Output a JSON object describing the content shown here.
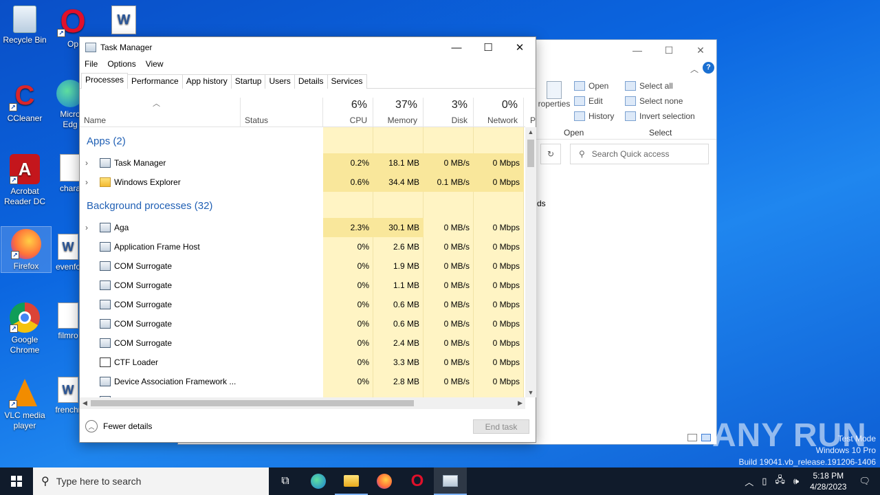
{
  "desktop": {
    "icons": [
      {
        "label": "Recycle Bin"
      },
      {
        "label": "Op"
      },
      {
        "label": ""
      },
      {
        "label": "CCleaner"
      },
      {
        "label": "Micro Edg"
      },
      {
        "label": "Acrobat Reader DC"
      },
      {
        "label": "chara"
      },
      {
        "label": "Firefox"
      },
      {
        "label": "evenfo"
      },
      {
        "label": "Google Chrome"
      },
      {
        "label": "filmro"
      },
      {
        "label": "VLC media player"
      },
      {
        "label": "frenchr"
      }
    ]
  },
  "explorer": {
    "ribbon": {
      "open_items": [
        "Open",
        "Edit",
        "History"
      ],
      "properties_label": "roperties",
      "open_group": "Open",
      "select_items": [
        "Select all",
        "Select none",
        "Invert selection"
      ],
      "select_group": "Select"
    },
    "search_placeholder": "Search Quick access",
    "content_fragment": "ds"
  },
  "task_manager": {
    "title": "Task Manager",
    "menu": [
      "File",
      "Options",
      "View"
    ],
    "tabs": [
      "Processes",
      "Performance",
      "App history",
      "Startup",
      "Users",
      "Details",
      "Services"
    ],
    "active_tab": "Processes",
    "columns": {
      "name": "Name",
      "status": "Status",
      "cpu": {
        "pct": "6%",
        "label": "CPU"
      },
      "memory": {
        "pct": "37%",
        "label": "Memory"
      },
      "disk": {
        "pct": "3%",
        "label": "Disk"
      },
      "network": {
        "pct": "0%",
        "label": "Network"
      },
      "power_fragment": "P"
    },
    "groups": {
      "apps": "Apps (2)",
      "background": "Background processes (32)"
    },
    "apps": [
      {
        "name": "Task Manager",
        "cpu": "0.2%",
        "memory": "18.1 MB",
        "disk": "0 MB/s",
        "network": "0 Mbps"
      },
      {
        "name": "Windows Explorer",
        "cpu": "0.6%",
        "memory": "34.4 MB",
        "disk": "0.1 MB/s",
        "network": "0 Mbps"
      }
    ],
    "background": [
      {
        "name": "Aga",
        "cpu": "2.3%",
        "memory": "30.1 MB",
        "disk": "0 MB/s",
        "network": "0 Mbps"
      },
      {
        "name": "Application Frame Host",
        "cpu": "0%",
        "memory": "2.6 MB",
        "disk": "0 MB/s",
        "network": "0 Mbps"
      },
      {
        "name": "COM Surrogate",
        "cpu": "0%",
        "memory": "1.9 MB",
        "disk": "0 MB/s",
        "network": "0 Mbps"
      },
      {
        "name": "COM Surrogate",
        "cpu": "0%",
        "memory": "1.1 MB",
        "disk": "0 MB/s",
        "network": "0 Mbps"
      },
      {
        "name": "COM Surrogate",
        "cpu": "0%",
        "memory": "0.6 MB",
        "disk": "0 MB/s",
        "network": "0 Mbps"
      },
      {
        "name": "COM Surrogate",
        "cpu": "0%",
        "memory": "0.6 MB",
        "disk": "0 MB/s",
        "network": "0 Mbps"
      },
      {
        "name": "COM Surrogate",
        "cpu": "0%",
        "memory": "2.4 MB",
        "disk": "0 MB/s",
        "network": "0 Mbps"
      },
      {
        "name": "CTF Loader",
        "cpu": "0%",
        "memory": "3.3 MB",
        "disk": "0 MB/s",
        "network": "0 Mbps"
      },
      {
        "name": "Device Association Framework ...",
        "cpu": "0%",
        "memory": "2.8 MB",
        "disk": "0 MB/s",
        "network": "0 Mbps"
      }
    ],
    "footer": {
      "fewer_details": "Fewer details",
      "end_task": "End task"
    }
  },
  "watermark": {
    "brand": "ANY RUN",
    "mode": "Test Mode",
    "os": "Windows 10 Pro",
    "build": "Build 19041.vb_release.191206-1406"
  },
  "taskbar": {
    "search_placeholder": "Type here to search",
    "time": "5:18 PM",
    "date": "4/28/2023"
  }
}
